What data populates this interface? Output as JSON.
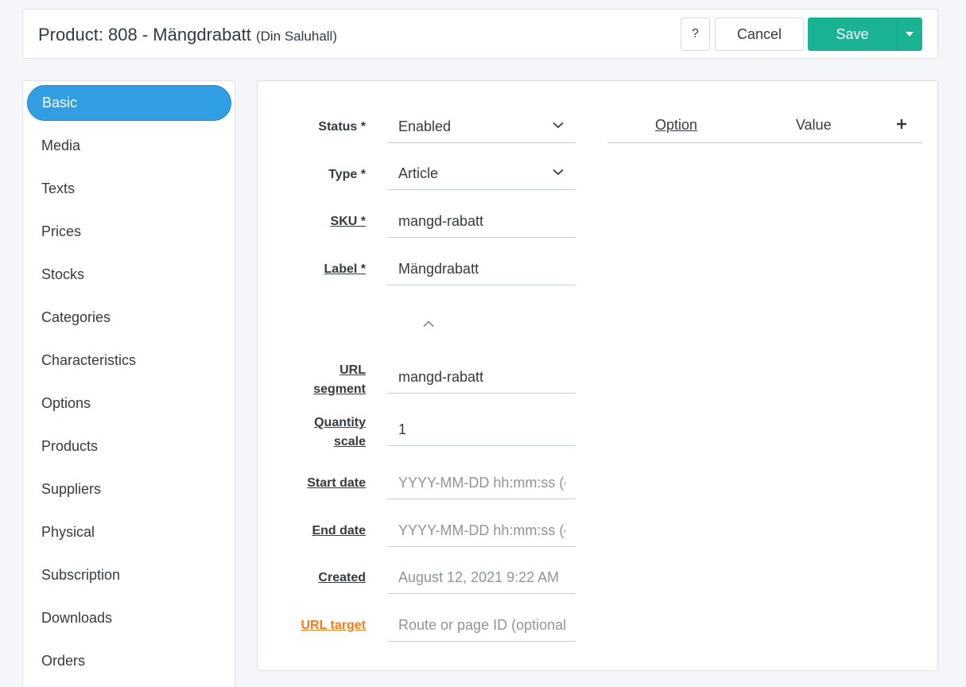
{
  "header": {
    "title": "Product: 808 - Mängdrabatt",
    "site": "(Din Saluhall)",
    "help_label": "?",
    "cancel_label": "Cancel",
    "save_label": "Save"
  },
  "sidebar": {
    "items": [
      {
        "label": "Basic",
        "active": true
      },
      {
        "label": "Media"
      },
      {
        "label": "Texts"
      },
      {
        "label": "Prices"
      },
      {
        "label": "Stocks"
      },
      {
        "label": "Categories"
      },
      {
        "label": "Characteristics"
      },
      {
        "label": "Options"
      },
      {
        "label": "Products"
      },
      {
        "label": "Suppliers"
      },
      {
        "label": "Physical"
      },
      {
        "label": "Subscription"
      },
      {
        "label": "Downloads"
      },
      {
        "label": "Orders"
      }
    ]
  },
  "form": {
    "status": {
      "label": "Status *",
      "value": "Enabled"
    },
    "type": {
      "label": "Type *",
      "value": "Article"
    },
    "sku": {
      "label": "SKU *",
      "value": "mangd-rabatt"
    },
    "label": {
      "label": "Label *",
      "value": "Mängdrabatt"
    },
    "url_segment": {
      "label_line1": "URL",
      "label_line2": "segment",
      "value": "mangd-rabatt"
    },
    "quantity_scale": {
      "label_line1": "Quantity",
      "label_line2": "scale",
      "value": "1"
    },
    "start_date": {
      "label": "Start date",
      "placeholder": "YYYY-MM-DD hh:mm:ss (optional)"
    },
    "end_date": {
      "label": "End date",
      "placeholder": "YYYY-MM-DD hh:mm:ss (optional)"
    },
    "created": {
      "label": "Created",
      "value": "August 12, 2021 9:22 AM"
    },
    "url_target": {
      "label": "URL target",
      "placeholder": "Route or page ID (optional)"
    }
  },
  "options_table": {
    "col_option": "Option",
    "col_value": "Value"
  },
  "colors": {
    "accent_green": "#19b394",
    "active_blue": "#319ee3",
    "warning_orange": "#f07d1a"
  }
}
